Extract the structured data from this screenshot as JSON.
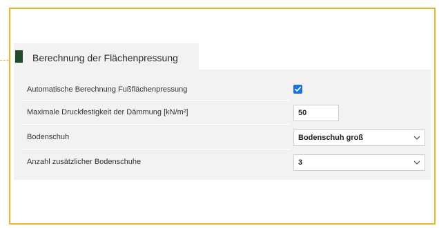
{
  "section": {
    "title": "Berechnung der Flächenpressung"
  },
  "rows": [
    {
      "label": "Automatische Berechnung Fußflächenpressung",
      "type": "checkbox",
      "checked": true
    },
    {
      "label": "Maximale Druckfestigkeit der Dämmung [kN/m²]",
      "type": "number",
      "value": "50"
    },
    {
      "label": "Bodenschuh",
      "type": "select",
      "value": "Bodenschuh groß"
    },
    {
      "label": "Anzahl zusätzlicher Bodenschuhe",
      "type": "select",
      "value": "3"
    }
  ],
  "colors": {
    "accent_border": "#efb423",
    "tab_marker": "#1f4a2c",
    "checkbox": "#1a73e8",
    "panel_bg": "#f2f2f2"
  },
  "icons": {
    "checkbox": "check-icon",
    "select_arrow": "chevron-down-icon"
  }
}
